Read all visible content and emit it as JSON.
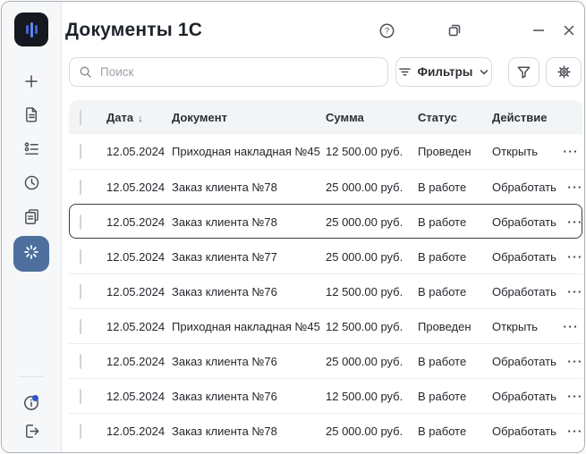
{
  "window": {
    "title": "Документы 1С",
    "controls": [
      {
        "icon": "help-icon",
        "glyph": "?"
      },
      {
        "icon": "restore-window-icon"
      },
      {
        "icon": "minimize-icon"
      },
      {
        "icon": "close-icon"
      }
    ]
  },
  "sidebar": {
    "logo_icon": "waveform-logo-icon",
    "items": [
      {
        "icon": "plus-icon"
      },
      {
        "icon": "document-icon"
      },
      {
        "icon": "checklist-icon"
      },
      {
        "icon": "clock-icon"
      },
      {
        "icon": "copy-documents-icon"
      },
      {
        "icon": "spinner-icon",
        "active": true
      }
    ],
    "footer": [
      {
        "icon": "info-icon",
        "notification_dot": true
      },
      {
        "icon": "logout-icon"
      }
    ]
  },
  "toolbar": {
    "search_placeholder": "Поиск",
    "search_icon": "search-icon",
    "filters_label": "Фильтры",
    "filters_icons": [
      "filter-lines-icon",
      "chevron-down-icon"
    ],
    "buttons": [
      {
        "icon": "funnel-icon"
      },
      {
        "icon": "gear-icon"
      }
    ]
  },
  "table": {
    "columns": [
      "Дата",
      "Документ",
      "Сумма",
      "Статус",
      "Действие"
    ],
    "sort": {
      "column": "Дата",
      "direction": "desc",
      "glyph": "↓"
    },
    "row_menu_glyph": "···",
    "selected_row_index": 2,
    "rows": [
      {
        "date": "12.05.2024",
        "document": "Приходная накладная №45",
        "amount": "12 500.00 руб.",
        "status": "Проведен",
        "action": "Открыть"
      },
      {
        "date": "12.05.2024",
        "document": "Заказ клиента №78",
        "amount": "25 000.00 руб.",
        "status": "В работе",
        "action": "Обработать"
      },
      {
        "date": "12.05.2024",
        "document": "Заказ клиента №78",
        "amount": "25 000.00 руб.",
        "status": "В работе",
        "action": "Обработать"
      },
      {
        "date": "12.05.2024",
        "document": "Заказ клиента №77",
        "amount": "25 000.00 руб.",
        "status": "В работе",
        "action": "Обработать"
      },
      {
        "date": "12.05.2024",
        "document": "Заказ клиента №76",
        "amount": "12 500.00 руб.",
        "status": "В работе",
        "action": "Обработать"
      },
      {
        "date": "12.05.2024",
        "document": "Приходная накладная №45",
        "amount": "12 500.00 руб.",
        "status": "Проведен",
        "action": "Открыть"
      },
      {
        "date": "12.05.2024",
        "document": "Заказ клиента №76",
        "amount": "25 000.00 руб.",
        "status": "В работе",
        "action": "Обработать"
      },
      {
        "date": "12.05.2024",
        "document": "Заказ клиента №76",
        "amount": "12 500.00 руб.",
        "status": "В работе",
        "action": "Обработать"
      },
      {
        "date": "12.05.2024",
        "document": "Заказ клиента №78",
        "amount": "25 000.00 руб.",
        "status": "В работе",
        "action": "Обработать"
      }
    ]
  },
  "colors": {
    "accent_active": "#4c6f9e",
    "notification_dot": "#2f55c9",
    "selection_border": "#383d44",
    "header_bg": "#f3f4f6",
    "sidebar_bg": "#f6f7f8"
  }
}
